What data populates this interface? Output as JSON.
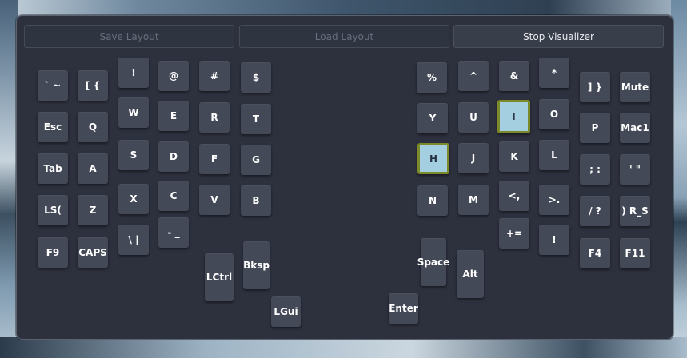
{
  "toolbar": {
    "save_label": "Save Layout",
    "load_label": "Load Layout",
    "stop_label": "Stop Visualizer"
  },
  "colors": {
    "window_bg": "#2d313e",
    "key_bg": "#444958",
    "key_pressed_bg": "#a3cfe0",
    "key_pressed_border": "#7c8a2a"
  },
  "keyboard": {
    "left": {
      "col0": [
        "` ~",
        "Esc",
        "Tab",
        "LS(",
        "F9"
      ],
      "col1": [
        "[ {",
        "Q",
        "A",
        "Z",
        "CAPS"
      ],
      "col2": [
        "!",
        "W",
        "S",
        "X",
        "\\ |"
      ],
      "col3": [
        "@",
        "E",
        "D",
        "C",
        "- _"
      ],
      "col4": [
        "#",
        "R",
        "F",
        "V"
      ],
      "col5": [
        "$",
        "T",
        "G",
        "B"
      ],
      "thumbs": [
        "LCtrl",
        "Bksp",
        "LGui"
      ]
    },
    "right": {
      "col0": [
        "%",
        "Y",
        "H",
        "N"
      ],
      "col1": [
        "^",
        "U",
        "J",
        "M"
      ],
      "col2": [
        "&",
        "I",
        "K",
        "<,",
        "+="
      ],
      "col3": [
        "*",
        "O",
        "L",
        ">.",
        "!"
      ],
      "col4": [
        "] }",
        "P",
        "; :",
        "/ ?",
        "F4"
      ],
      "col5": [
        "Mute",
        "Mac1",
        "' \"",
        ") R_S",
        "F11"
      ],
      "thumbs": [
        "Space",
        "Alt",
        "Enter"
      ]
    },
    "pressed_keys": [
      "I",
      "H"
    ]
  }
}
